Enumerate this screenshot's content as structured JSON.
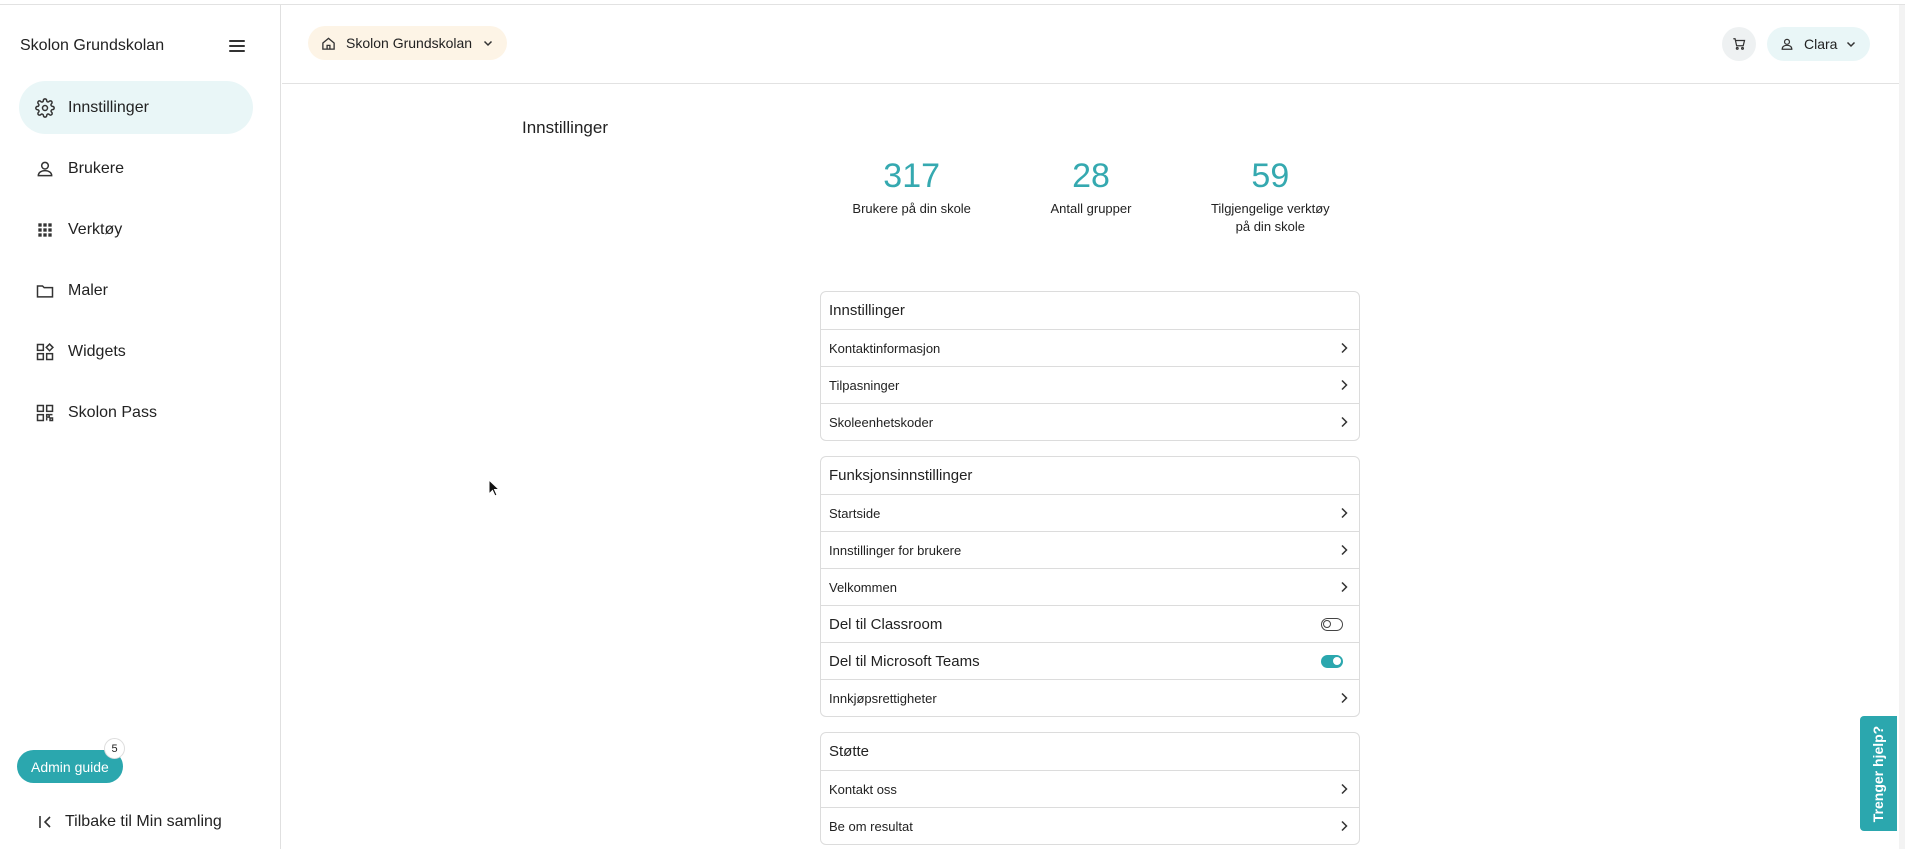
{
  "sidebar": {
    "title": "Skolon Grundskolan",
    "items": [
      {
        "label": "Innstillinger",
        "icon": "gear-icon",
        "active": true
      },
      {
        "label": "Brukere",
        "icon": "person-icon"
      },
      {
        "label": "Verktøy",
        "icon": "grid-icon"
      },
      {
        "label": "Maler",
        "icon": "folder-icon"
      },
      {
        "label": "Widgets",
        "icon": "widgets-icon"
      },
      {
        "label": "Skolon Pass",
        "icon": "qr-icon"
      }
    ],
    "admin_guide": "Admin guide",
    "admin_guide_badge": "5",
    "back_label": "Tilbake til Min samling"
  },
  "header": {
    "school": "Skolon Grundskolan",
    "user": "Clara"
  },
  "main": {
    "title": "Innstillinger",
    "stats": [
      {
        "value": "317",
        "label": "Brukere på din skole"
      },
      {
        "value": "28",
        "label": "Antall grupper"
      },
      {
        "value": "59",
        "label": "Tilgjengelige verktøy på din skole"
      }
    ],
    "sections": [
      {
        "title": "Innstillinger",
        "rows": [
          "Kontaktinformasjon",
          "Tilpasninger",
          "Skoleenhetskoder"
        ]
      },
      {
        "title": "Funksjonsinnstillinger",
        "rows": [
          "Startside",
          "Innstillinger for brukere",
          "Velkommen",
          "Del til Classroom",
          "Del til Microsoft Teams",
          "Innkjøpsrettigheter"
        ],
        "toggles": {
          "Del til Classroom": false,
          "Del til Microsoft Teams": true
        }
      },
      {
        "title": "Støtte",
        "rows": [
          "Kontakt oss",
          "Be om resultat"
        ]
      }
    ]
  },
  "help_tab": "Trenger hjelp?",
  "colors": {
    "accent": "#2ba7ae",
    "active_bg": "#e9f6f7",
    "school_pill_bg": "#fdf4e6"
  }
}
